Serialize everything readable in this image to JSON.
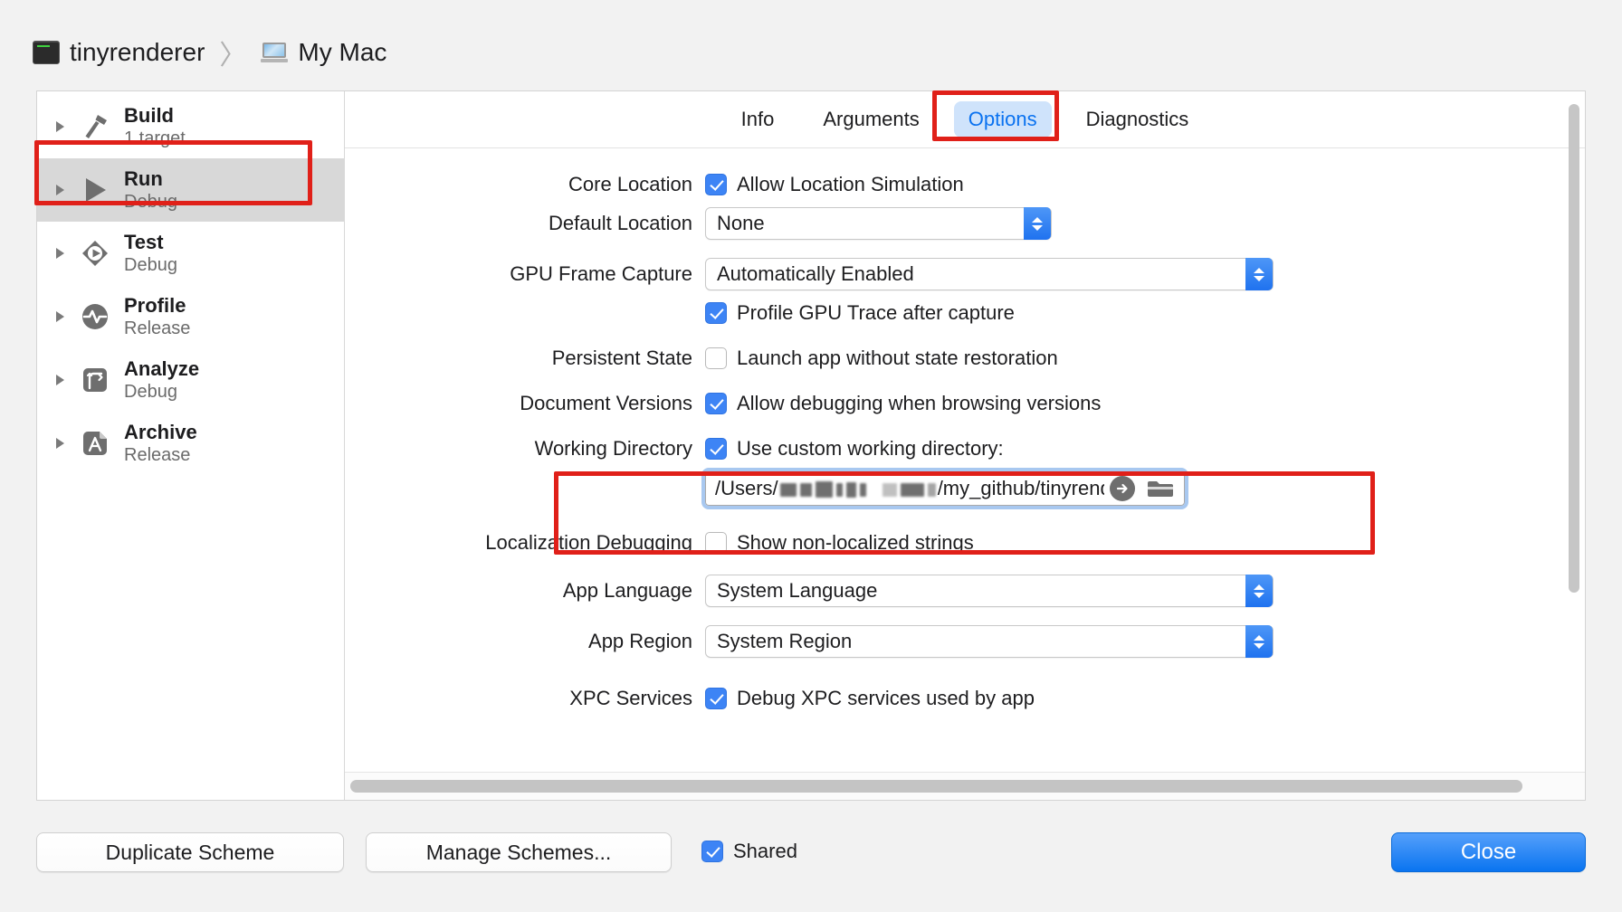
{
  "breadcrumb": {
    "project": "tinyrenderer",
    "separator": "〉",
    "destination": "My Mac",
    "project_icon": "terminal-icon",
    "destination_icon": "laptop-icon"
  },
  "sidebar": {
    "items": [
      {
        "title": "Build",
        "subtitle": "1 target",
        "icon": "hammer-icon",
        "selected": false
      },
      {
        "title": "Run",
        "subtitle": "Debug",
        "icon": "play-icon",
        "selected": true
      },
      {
        "title": "Test",
        "subtitle": "Debug",
        "icon": "test-diamond-icon",
        "selected": false
      },
      {
        "title": "Profile",
        "subtitle": "Release",
        "icon": "pulse-circle-icon",
        "selected": false
      },
      {
        "title": "Analyze",
        "subtitle": "Debug",
        "icon": "analyze-arrow-icon",
        "selected": false
      },
      {
        "title": "Archive",
        "subtitle": "Release",
        "icon": "archive-box-icon",
        "selected": false
      }
    ]
  },
  "tabs": [
    {
      "label": "Info",
      "active": false
    },
    {
      "label": "Arguments",
      "active": false
    },
    {
      "label": "Options",
      "active": true
    },
    {
      "label": "Diagnostics",
      "active": false
    }
  ],
  "options": {
    "core_location": {
      "label": "Core Location",
      "checkbox_label": "Allow Location Simulation",
      "checked": true
    },
    "default_location": {
      "label": "Default Location",
      "value": "None"
    },
    "gpu_frame_capture": {
      "label": "GPU Frame Capture",
      "value": "Automatically Enabled"
    },
    "profile_gpu_trace": {
      "checkbox_label": "Profile GPU Trace after capture",
      "checked": true
    },
    "persistent_state": {
      "label": "Persistent State",
      "checkbox_label": "Launch app without state restoration",
      "checked": false
    },
    "document_versions": {
      "label": "Document Versions",
      "checkbox_label": "Allow debugging when browsing versions",
      "checked": true
    },
    "working_directory": {
      "label": "Working Directory",
      "checkbox_label": "Use custom working directory:",
      "checked": true,
      "path_prefix": "/Users/",
      "path_suffix": "/my_github/tinyrendere",
      "path_redacted": true,
      "reveal_icon": "arrow-right-circle-icon",
      "browse_icon": "folder-icon"
    },
    "localization_debugging": {
      "label": "Localization Debugging",
      "checkbox_label": "Show non-localized strings",
      "checked": false
    },
    "app_language": {
      "label": "App Language",
      "value": "System Language"
    },
    "app_region": {
      "label": "App Region",
      "value": "System Region"
    },
    "xpc_services": {
      "label": "XPC Services",
      "checkbox_label": "Debug XPC services used by app",
      "checked": true
    }
  },
  "bottom_bar": {
    "duplicate_scheme": "Duplicate Scheme",
    "manage_schemes": "Manage Schemes...",
    "shared_label": "Shared",
    "shared_checked": true,
    "close": "Close"
  },
  "colors": {
    "accent_blue": "#0a72f0",
    "tab_active_bg": "#cfe3fb",
    "checkbox_blue": "#3d84f5",
    "annotation_red": "#e02019",
    "selected_row": "#d8d8d8"
  }
}
